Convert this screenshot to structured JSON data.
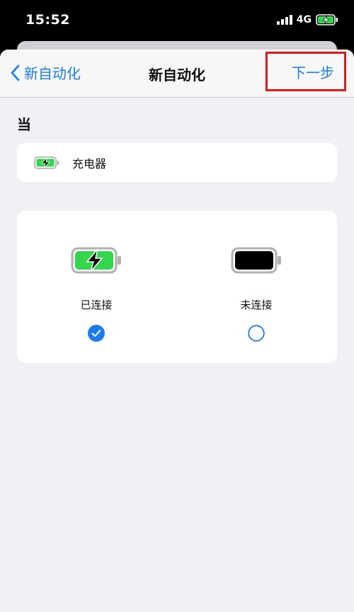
{
  "status_bar": {
    "time": "15:52",
    "network": "4G"
  },
  "nav": {
    "back_label": "新自动化",
    "title": "新自动化",
    "next_label": "下一步"
  },
  "section": {
    "label": "当"
  },
  "trigger": {
    "label": "充电器",
    "icon": "battery-charging-icon"
  },
  "options": [
    {
      "label": "已连接",
      "icon": "battery-charging-icon",
      "selected": true
    },
    {
      "label": "未连接",
      "icon": "battery-full-icon",
      "selected": false
    }
  ],
  "colors": {
    "accent": "#1a7cf2",
    "charge_green": "#32d74b",
    "highlight_red": "#e01a1a",
    "background": "#f0f0f5"
  }
}
